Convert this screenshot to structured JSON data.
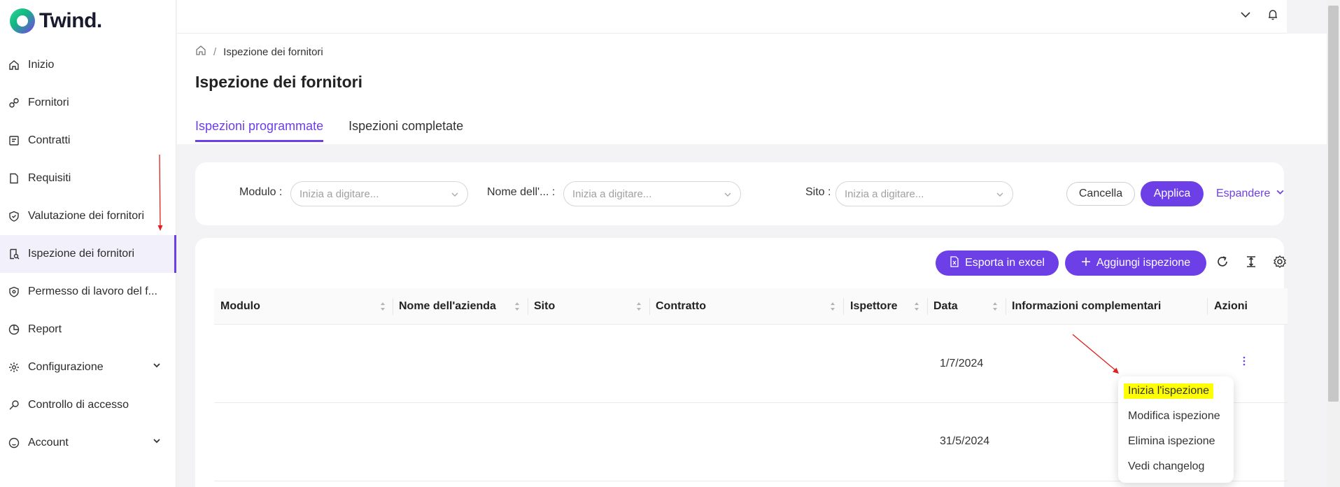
{
  "app": {
    "name": "Twind."
  },
  "sidebar": {
    "items": [
      {
        "label": "Inizio",
        "icon": "home-icon"
      },
      {
        "label": "Fornitori",
        "icon": "link-icon"
      },
      {
        "label": "Contratti",
        "icon": "contract-icon"
      },
      {
        "label": "Requisiti",
        "icon": "document-icon"
      },
      {
        "label": "Valutazione dei fornitori",
        "icon": "shield-check-icon"
      },
      {
        "label": "Ispezione dei fornitori",
        "icon": "inspection-icon",
        "active": true
      },
      {
        "label": "Permesso di lavoro del f...",
        "icon": "shield-lock-icon"
      },
      {
        "label": "Report",
        "icon": "pie-chart-icon"
      },
      {
        "label": "Configurazione",
        "icon": "gear-icon",
        "expandable": true
      },
      {
        "label": "Controllo di accesso",
        "icon": "key-icon"
      },
      {
        "label": "Account",
        "icon": "user-circle-icon",
        "expandable": true
      }
    ]
  },
  "breadcrumb": {
    "current": "Ispezione dei fornitori"
  },
  "page": {
    "title": "Ispezione dei fornitori"
  },
  "tabs": [
    {
      "label": "Ispezioni programmate",
      "active": true
    },
    {
      "label": "Ispezioni completate",
      "active": false
    }
  ],
  "filters": {
    "modulo": {
      "label": "Modulo",
      "placeholder": "Inizia a digitare..."
    },
    "nome": {
      "label": "Nome dell'...",
      "placeholder": "Inizia a digitare..."
    },
    "sito": {
      "label": "Sito",
      "placeholder": "Inizia a digitare..."
    },
    "cancel_label": "Cancella",
    "apply_label": "Applica",
    "expand_label": "Espandere"
  },
  "toolbar": {
    "export_label": "Esporta in excel",
    "add_label": "Aggiungi ispezione"
  },
  "table": {
    "columns": [
      "Modulo",
      "Nome dell'azienda",
      "Sito",
      "Contratto",
      "Ispettore",
      "Data",
      "Informazioni complementari",
      "Azioni"
    ],
    "rows": [
      {
        "modulo": "",
        "azienda": "",
        "sito": "",
        "contratto": "",
        "ispettore": "",
        "data": "1/7/2024",
        "info": ""
      },
      {
        "modulo": "",
        "azienda": "",
        "sito": "",
        "contratto": "",
        "ispettore": "",
        "data": "31/5/2024",
        "info": ""
      }
    ]
  },
  "action_menu": {
    "items": [
      {
        "label": "Inizia l'ispezione",
        "highlighted": true
      },
      {
        "label": "Modifica ispezione"
      },
      {
        "label": "Elimina ispezione"
      },
      {
        "label": "Vedi changelog"
      }
    ]
  },
  "colors": {
    "accent": "#6d3fe6",
    "highlight": "#ffff00",
    "annotation": "#e02020"
  }
}
